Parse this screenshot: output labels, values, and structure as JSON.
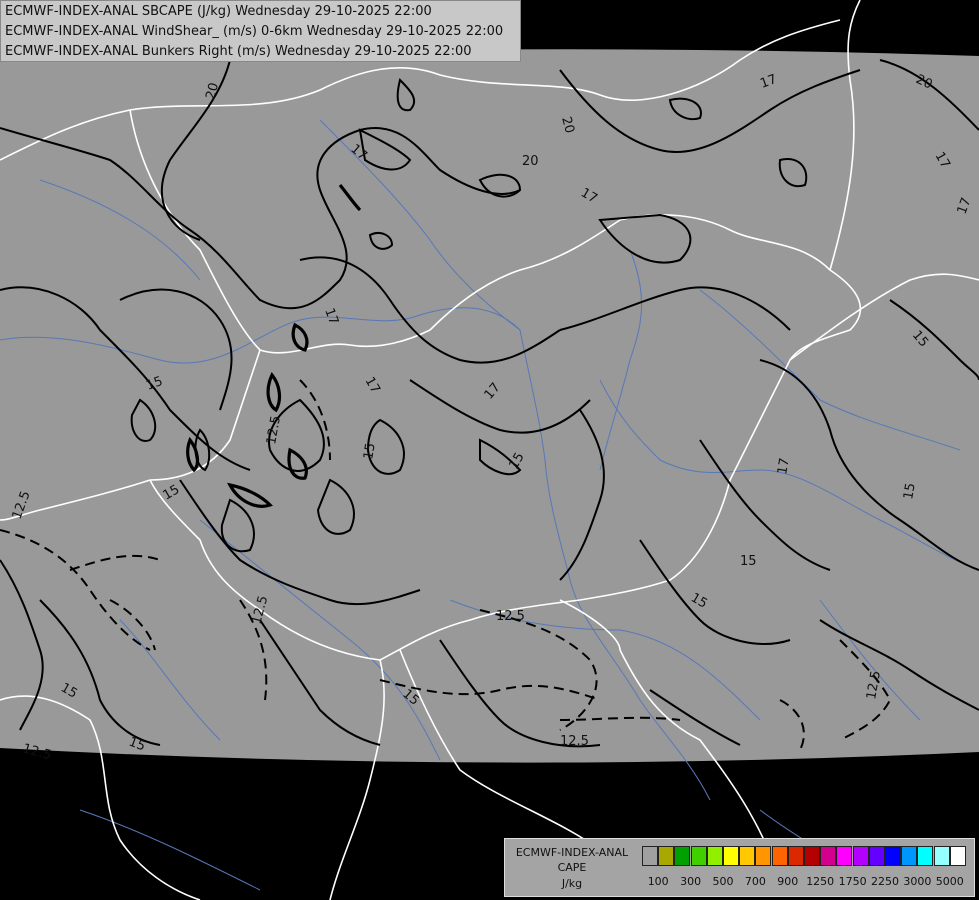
{
  "titles": [
    "ECMWF-INDEX-ANAL SBCAPE (J/kg) Wednesday 29-10-2025 22:00",
    "ECMWF-INDEX-ANAL WindShear_ (m/s) 0-6km Wednesday 29-10-2025 22:00",
    "ECMWF-INDEX-ANAL Bunkers Right (m/s) Wednesday 29-10-2025 22:00"
  ],
  "legend": {
    "line1": "ECMWF-INDEX-ANAL",
    "line2": "CAPE",
    "line3": "J/kg",
    "swatches": [
      "#a0a0a0",
      "#a8a800",
      "#00a000",
      "#40d000",
      "#90f000",
      "#ffff00",
      "#ffc800",
      "#ff9600",
      "#ff6400",
      "#dc2800",
      "#b40000",
      "#d2008c",
      "#ff00ff",
      "#b400ff",
      "#6400ff",
      "#0000ff",
      "#0096ff",
      "#00ffff",
      "#96ffff",
      "#ffffff"
    ],
    "ticks": [
      "100",
      "300",
      "500",
      "700",
      "900",
      "1250",
      "1750",
      "2250",
      "3000",
      "5000"
    ]
  },
  "contour_labels": [
    {
      "id": "c1",
      "text": "20"
    },
    {
      "id": "c2",
      "text": "20"
    },
    {
      "id": "c3",
      "text": "20"
    },
    {
      "id": "c4",
      "text": "20"
    },
    {
      "id": "c5",
      "text": "17"
    },
    {
      "id": "c6",
      "text": "17"
    },
    {
      "id": "c7",
      "text": "17"
    },
    {
      "id": "c8",
      "text": "17"
    },
    {
      "id": "c9",
      "text": "17"
    },
    {
      "id": "c10",
      "text": "17"
    },
    {
      "id": "c11",
      "text": "17"
    },
    {
      "id": "c12",
      "text": "17"
    },
    {
      "id": "c13",
      "text": "15"
    },
    {
      "id": "c14",
      "text": "15"
    },
    {
      "id": "c15",
      "text": "15"
    },
    {
      "id": "c16",
      "text": "15"
    },
    {
      "id": "c17",
      "text": "15"
    },
    {
      "id": "c18",
      "text": "15"
    },
    {
      "id": "c19",
      "text": "15"
    },
    {
      "id": "c20",
      "text": "15"
    },
    {
      "id": "c21",
      "text": "15"
    },
    {
      "id": "c22",
      "text": "15"
    },
    {
      "id": "c23",
      "text": "12.5"
    },
    {
      "id": "c24",
      "text": "12.5"
    },
    {
      "id": "c25",
      "text": "12.5"
    },
    {
      "id": "c26",
      "text": "12.5"
    },
    {
      "id": "c27",
      "text": "12.5"
    },
    {
      "id": "c28",
      "text": "12.5"
    },
    {
      "id": "c29",
      "text": "12.5"
    },
    {
      "id": "c30",
      "text": "17"
    },
    {
      "id": "c31",
      "text": "15"
    }
  ]
}
